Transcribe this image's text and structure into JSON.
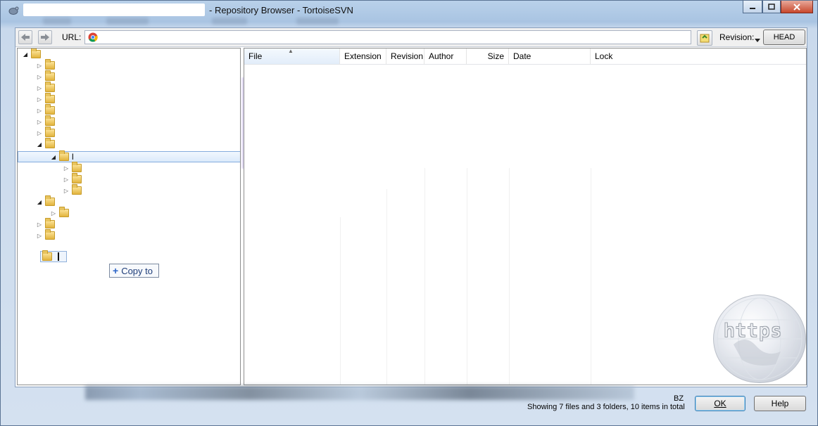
{
  "window": {
    "title": "- Repository Browser - TortoiseSVN",
    "minimize_label": "–",
    "maximize_label": "□",
    "close_label": "✕"
  },
  "toolbar": {
    "back_icon": "arrow-left-icon",
    "forward_icon": "arrow-right-icon",
    "url_label": "URL:",
    "url_value": "",
    "url_icon": "chrome-icon",
    "revision_label": "Revision:",
    "revision_value": "HEAD"
  },
  "tree": {
    "selected_label": "l",
    "drag_tooltip": "Copy to"
  },
  "list": {
    "columns": [
      "File",
      "Extension",
      "Revision",
      "Author",
      "Size",
      "Date",
      "Lock"
    ],
    "sorted_column": "File"
  },
  "status": {
    "badge": "BZ",
    "summary": "Showing 7 files and 3 folders, 10 items in total"
  },
  "buttons": {
    "ok": "OK",
    "help": "Help"
  },
  "watermark": {
    "text": "https"
  }
}
